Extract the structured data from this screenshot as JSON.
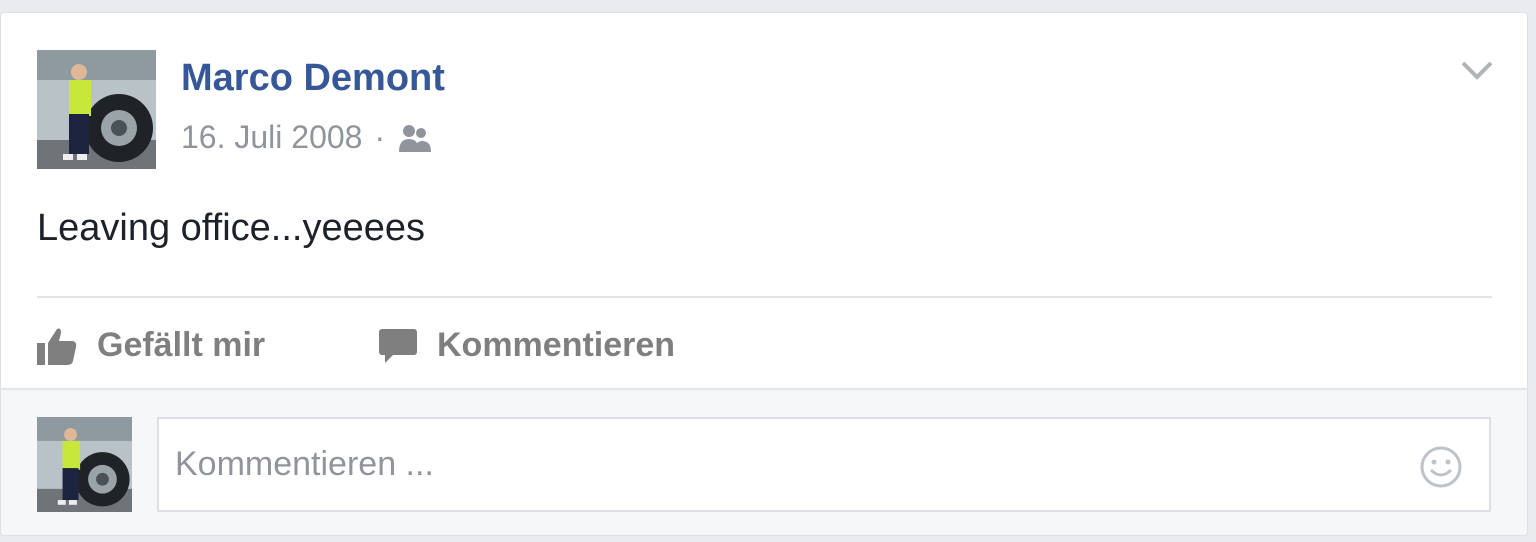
{
  "post": {
    "author": "Marco Demont",
    "date": "16. Juli 2008",
    "separator": "·",
    "audience_icon": "friends-icon",
    "text": "Leaving office...yeeees",
    "menu_icon": "chevron-down-icon"
  },
  "actions": {
    "like_label": "Gefällt mir",
    "comment_label": "Kommentieren"
  },
  "comment_box": {
    "placeholder": "Kommentieren ...",
    "emoji_icon": "smiley-icon"
  },
  "colors": {
    "author": "#365899",
    "meta": "#90949c",
    "action": "#7f7f7f",
    "background": "#e9ebee"
  }
}
